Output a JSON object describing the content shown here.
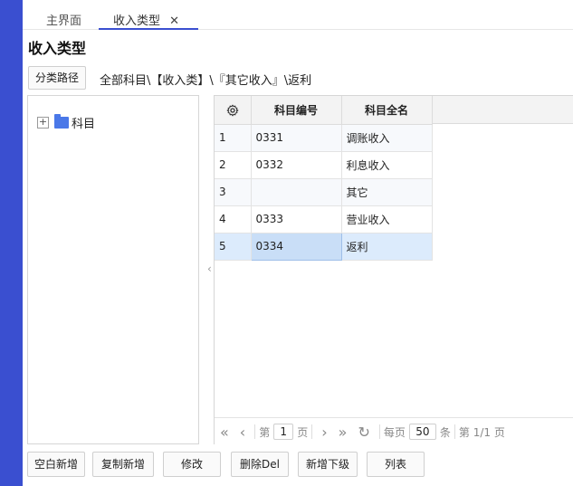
{
  "tabs": {
    "home": "主界面",
    "active": "收入类型"
  },
  "page": {
    "title": "收入类型"
  },
  "path": {
    "button_label": "分类路径",
    "text": "全部科目\\【收入类】\\『其它收入』\\返利"
  },
  "tree": {
    "root_label": "科目",
    "expand_glyph": "+"
  },
  "grid": {
    "headers": {
      "code": "科目编号",
      "name": "科目全名"
    },
    "rows": [
      {
        "idx": "1",
        "code": "0331",
        "name": "调账收入"
      },
      {
        "idx": "2",
        "code": "0332",
        "name": "利息收入"
      },
      {
        "idx": "3",
        "code": "",
        "name": "其它"
      },
      {
        "idx": "4",
        "code": "0333",
        "name": "营业收入"
      },
      {
        "idx": "5",
        "code": "0334",
        "name": "返利"
      }
    ],
    "selected_row": "5"
  },
  "pager": {
    "page_prefix": "第",
    "current_page": "1",
    "page_suffix": "页",
    "per_page_prefix": "每页",
    "per_page": "50",
    "per_page_suffix": "条",
    "summary": "第 1/1 页"
  },
  "actions": {
    "blank_new": "空白新增",
    "copy_new": "复制新增",
    "edit": "修改",
    "delete": "删除Del",
    "add_child": "新增下级",
    "list": "列表"
  },
  "icons": {
    "close": "close-icon",
    "settings": "gear-icon",
    "folder": "folder-icon"
  },
  "colors": {
    "accent": "#3a4fd0",
    "selected_row": "#dcebfc",
    "folder": "#4a78e8"
  }
}
